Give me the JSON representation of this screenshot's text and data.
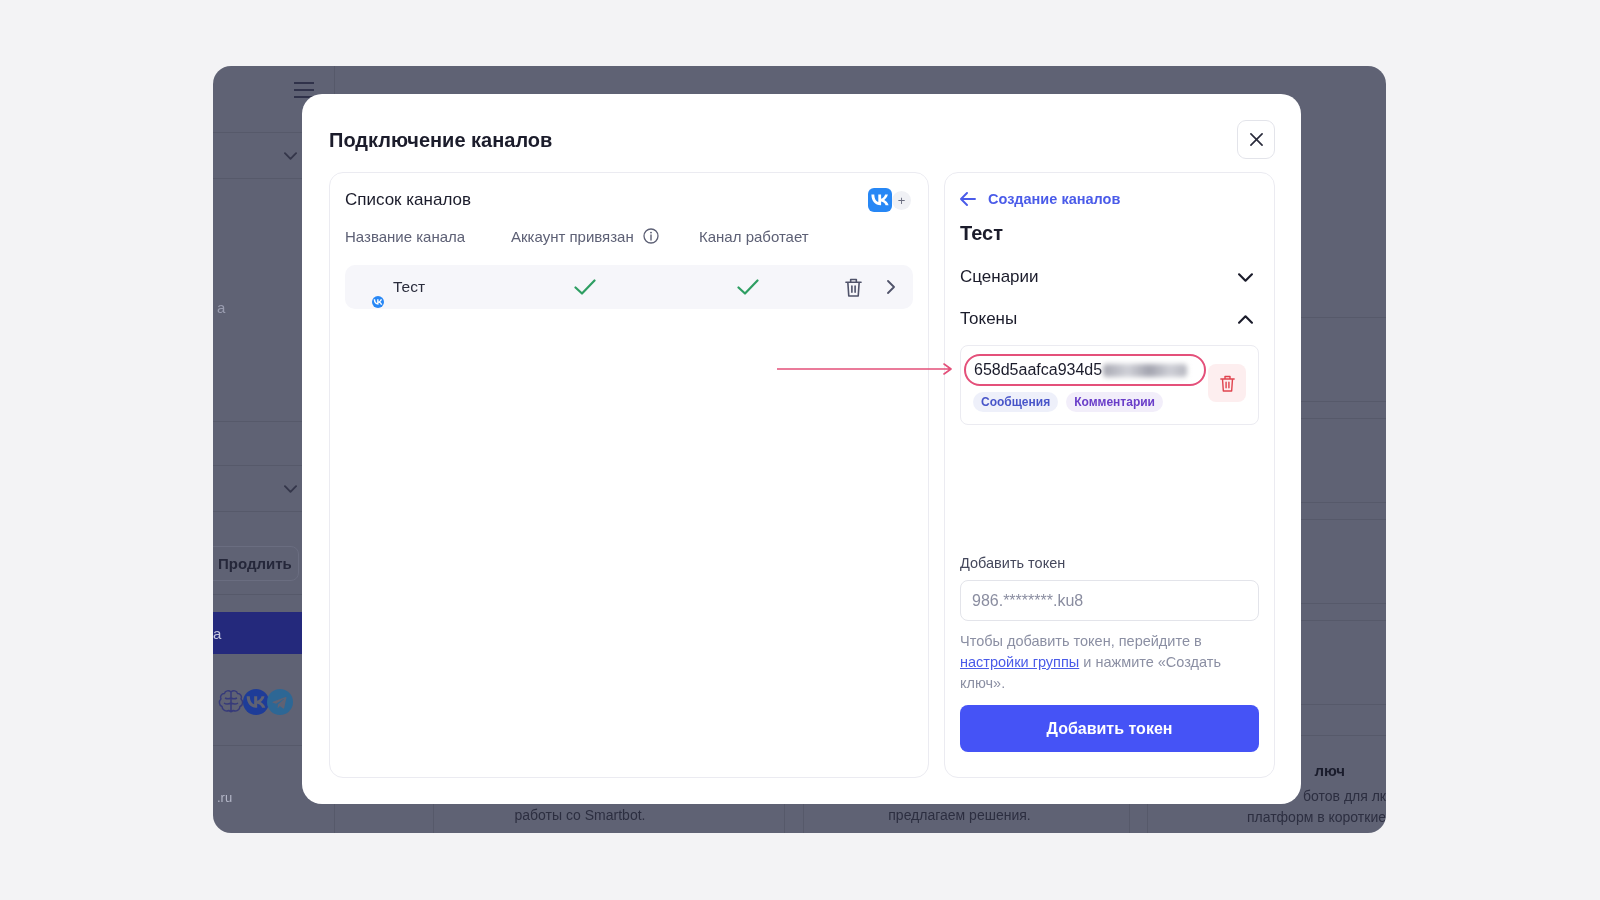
{
  "background_app": {
    "sidebar": {
      "fragment_text": "а",
      "renew_button": "Продлить",
      "active_item": "а",
      "footer_text": ".ru"
    },
    "cards": [
      {
        "kind": "caption",
        "text": "работы со Smartbot."
      },
      {
        "kind": "caption",
        "text": "предлагаем решения."
      },
      {
        "kind": "feature",
        "title": "люч",
        "lines": [
          "ботов для лк",
          "платформ в короткие"
        ]
      }
    ]
  },
  "modal": {
    "title": "Подключение каналов",
    "channel_list": {
      "title": "Список каналов",
      "add_button": "+",
      "columns": [
        {
          "label": "Название канала",
          "info": false
        },
        {
          "label": "Аккаунт привязан",
          "info": true
        },
        {
          "label": "Канал работает",
          "info": false
        }
      ],
      "rows": [
        {
          "name": "Тест",
          "account_linked": true,
          "working": true
        }
      ]
    },
    "channel_detail": {
      "back_link": "Создание каналов",
      "title": "Тест",
      "sections": [
        {
          "title": "Сценарии",
          "expanded": false
        },
        {
          "title": "Токены",
          "expanded": true
        }
      ],
      "tokens": [
        {
          "value": "658d5aafca934d5",
          "redacted": true,
          "highlighted": true,
          "scopes": [
            {
              "label": "Сообщения",
              "color": "#4855c9"
            },
            {
              "label": "Комментарии",
              "color": "#6a3ec9"
            }
          ]
        }
      ],
      "add_token": {
        "label": "Добавить токен",
        "placeholder": "986.********.ku8",
        "hint_before": "Чтобы добавить токен, перейдите в ",
        "hint_link": "настройки группы",
        "hint_after": " и нажмите «Создать ключ».",
        "button": "Добавить токен"
      }
    }
  }
}
